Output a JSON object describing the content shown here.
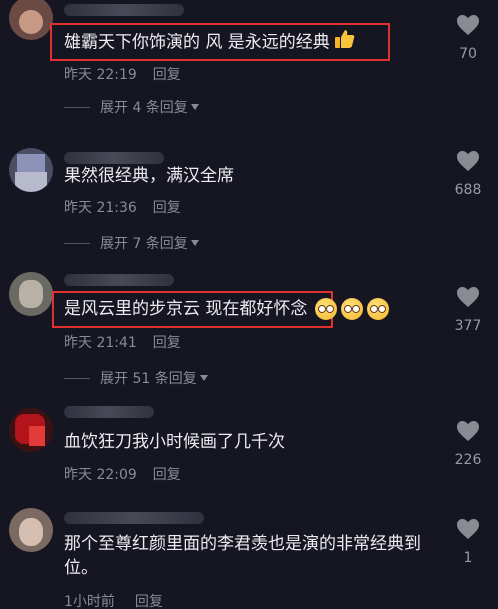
{
  "comments": [
    {
      "text": "雄霸天下你饰演的 风 是永远的经典",
      "emoji": "thumbs-up",
      "time": "昨天 22:19",
      "reply": "回复",
      "expand": "展开 4 条回复",
      "likes": "70"
    },
    {
      "text": "果然很经典，满汉全席",
      "time": "昨天 21:36",
      "reply": "回复",
      "expand": "展开 7 条回复",
      "likes": "688"
    },
    {
      "text": "是风云里的步京云 现在都好怀念",
      "emoji": "pleading-face x3",
      "time": "昨天 21:41",
      "reply": "回复",
      "expand": "展开 51 条回复",
      "likes": "377"
    },
    {
      "text": "血饮狂刀我小时候画了几千次",
      "time": "昨天 22:09",
      "reply": "回复",
      "likes": "226"
    },
    {
      "text": "那个至尊红颜里面的李君羡也是演的非常经典到位。",
      "time": "1小时前",
      "reply": "回复",
      "likes": "1"
    }
  ],
  "colors": {
    "background": "#161622",
    "highlight_box": "#e03030",
    "secondary_text": "#8a8a95"
  },
  "icons": {
    "like": "heart-icon",
    "expand": "caret-down-icon"
  }
}
